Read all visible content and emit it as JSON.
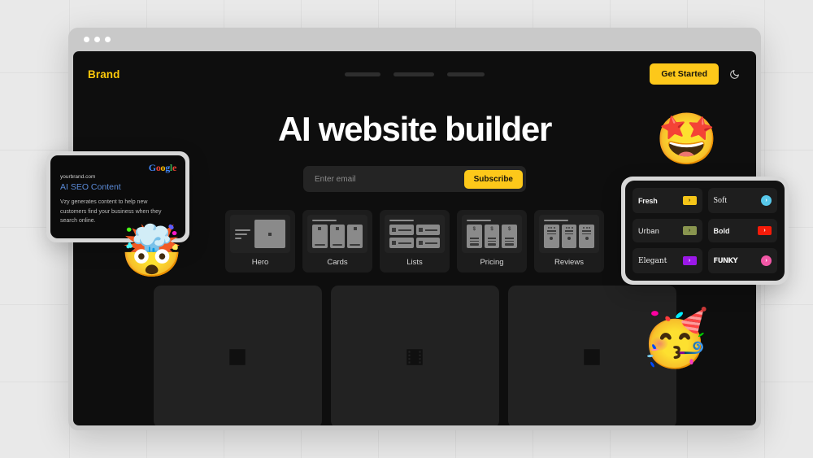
{
  "window": {
    "traffic_lights": [
      "dot",
      "dot",
      "dot"
    ]
  },
  "site": {
    "brand": "Brand",
    "nav_placeholders": [
      "",
      "",
      ""
    ],
    "get_started_label": "Get Started",
    "theme_toggle_icon": "moon-icon",
    "headline": "AI website builder",
    "email": {
      "placeholder": "Enter email",
      "value": "",
      "subscribe_label": "Subscribe"
    },
    "section_cards": [
      {
        "label": "Hero",
        "icon": "hero-layout-icon"
      },
      {
        "label": "Cards",
        "icon": "cards-layout-icon"
      },
      {
        "label": "Lists",
        "icon": "lists-layout-icon"
      },
      {
        "label": "Pricing",
        "icon": "pricing-layout-icon"
      },
      {
        "label": "Reviews",
        "icon": "reviews-layout-icon"
      }
    ],
    "media_placeholders": [
      {
        "icon": "image-placeholder-icon"
      },
      {
        "icon": "video-placeholder-icon"
      },
      {
        "icon": "image-placeholder-icon"
      }
    ]
  },
  "seo_card": {
    "logo_letters": [
      "G",
      "o",
      "o",
      "g",
      "l",
      "e"
    ],
    "url": "yourbrand.com",
    "title": "AI SEO Content",
    "description": "Vzy  generates content to help new customers find your business when they search online."
  },
  "style_picker": {
    "items": [
      {
        "name": "Fresh",
        "chip_color": "#f5c518",
        "chip_shape": "square",
        "chevron": "›"
      },
      {
        "name": "Soft",
        "chip_color": "#57c8ea",
        "chip_shape": "circle",
        "chevron": "›"
      },
      {
        "name": "Urban",
        "chip_color": "#89954f",
        "chip_shape": "square",
        "chevron": "›"
      },
      {
        "name": "Bold",
        "chip_color": "#f51b09",
        "chip_shape": "square",
        "chevron": "›"
      },
      {
        "name": "Elegant",
        "chip_color": "#9b18e8",
        "chip_shape": "square",
        "chevron": "›"
      },
      {
        "name": "FUNKY",
        "chip_color": "#f257a6",
        "chip_shape": "circle",
        "chevron": "›"
      }
    ]
  },
  "decorations": {
    "memoji_star": "🤩",
    "memoji_mind_blown": "🤯",
    "memoji_party": "🥳"
  },
  "colors": {
    "brand_yellow": "#fdc81a",
    "page_background": "#e9e9e9",
    "viewport_background": "#0e0e0e"
  }
}
